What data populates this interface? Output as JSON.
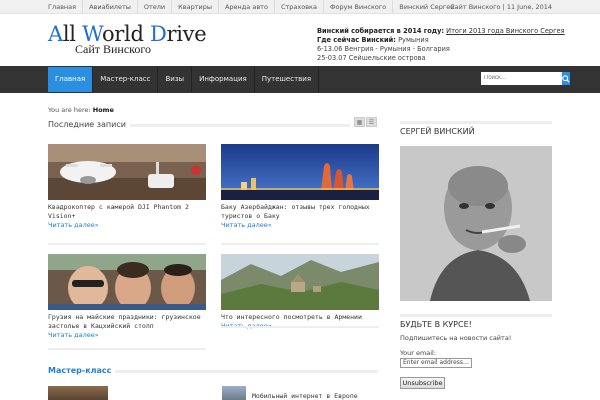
{
  "topbar": {
    "links": [
      "Главная",
      "Авиабилеты",
      "Отели",
      "Квартиры",
      "Аренда авто",
      "Страховка",
      "Форум Винского",
      "Винский Сергей"
    ],
    "date_text": "Сайт Винского | 11 June, 2014"
  },
  "logo": {
    "word1_initial": "A",
    "word1_rest": "ll ",
    "word2_initial": "W",
    "word2_rest": "orld ",
    "word3_initial": "D",
    "word3_rest": "rive",
    "subtitle": "Сайт Винского",
    "accent_color": "#1d6fd1"
  },
  "header_info": {
    "line1_label": "Винский собирается в 2014 году:",
    "line1_link": "Итоги 2013 года Винского Сергея",
    "line2_label": "Где сейчас Винский:",
    "line2_value": "Румыния",
    "line3": "6-13.06 Венгрия - Румыния - Болгария",
    "line4": "25-03.07 Сейшельские острова"
  },
  "nav": {
    "items": [
      "Главная",
      "Мастер-класс",
      "Визы",
      "Информация",
      "Путешествия"
    ],
    "active_index": 0,
    "active_color": "#2a8fe0",
    "search_placeholder": "Поиск..."
  },
  "breadcrumb": {
    "prefix": "You are here:",
    "current": "Home"
  },
  "latest": {
    "title": "Последние записи",
    "posts": [
      {
        "title": "Квадрокоптер с камерой DJI Phantom 2 Vision+",
        "more": "Читать далее»"
      },
      {
        "title": "Баку Азербайджан: отзывы трех голодных туристов о Баку",
        "more": "Читать далее»"
      },
      {
        "title": "Грузия на майские праздники: грузинское застолье в Кацхийский столп",
        "more": "Читать далее»"
      },
      {
        "title": "Что интересного посмотреть в Армении",
        "more": "Читать далее»"
      }
    ]
  },
  "master_class": {
    "title": "Мастер-класс",
    "post_title": "Мобильный интернет в Европе"
  },
  "sidebar": {
    "author_title": "СЕРГЕЙ ВИНСКИЙ",
    "subscribe_title": "БУДЬТЕ В КУРСЕ!",
    "subscribe_text": "Подпишитесь на новости сайта!",
    "email_label": "Your email:",
    "email_placeholder": "Enter email address...",
    "subscribe_button": "Unsubscribe"
  }
}
